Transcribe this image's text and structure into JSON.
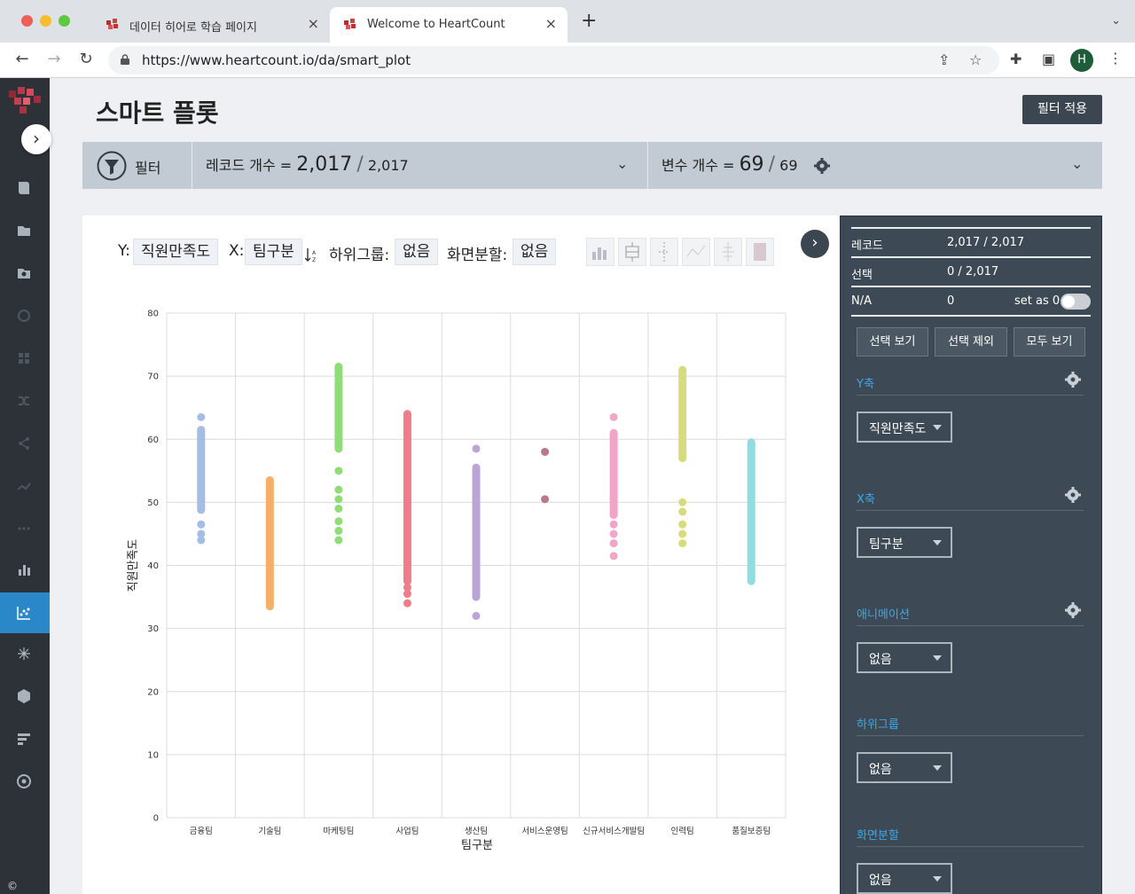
{
  "browser": {
    "tabs": [
      {
        "title": "데이터 히어로 학습 페이지",
        "active": false
      },
      {
        "title": "Welcome to HeartCount",
        "active": true
      }
    ],
    "url": "https://www.heartcount.io/da/smart_plot",
    "profile_initial": "H"
  },
  "page": {
    "title": "스마트 플롯",
    "apply_filter_label": "필터 적용"
  },
  "filterbar": {
    "filter_label": "필터",
    "record_label": "레코드 개수 =",
    "record_selected": "2,017",
    "record_sep": "/",
    "record_total": "2,017",
    "var_label": "변수 개수 =",
    "var_selected": "69",
    "var_sep": "/",
    "var_total": "69"
  },
  "controls": {
    "y_label": "Y:",
    "y_value": "직원만족도",
    "x_label": "X:",
    "x_value": "팀구분",
    "sort_icon": "sort-az-icon",
    "subgroup_label": "하위그룹:",
    "subgroup_value": "없음",
    "split_label": "화면분할:",
    "split_value": "없음"
  },
  "panel": {
    "rows": [
      {
        "key": "레코드",
        "value": "2,017 / 2,017"
      },
      {
        "key": "선택",
        "value": "0 / 2,017"
      },
      {
        "key": "N/A",
        "value": "0",
        "toggle_label": "set as 0",
        "toggle_on": false
      }
    ],
    "buttons": [
      "선택 보기",
      "선택 제외",
      "모두 보기"
    ],
    "sections": [
      {
        "title": "Y축",
        "value": "직원만족도",
        "gear": true
      },
      {
        "title": "X축",
        "value": "팀구분",
        "gear": true
      },
      {
        "title": "애니메이션",
        "value": "없음",
        "gear": true
      },
      {
        "title": "하위그룹",
        "value": "없음",
        "gear": false
      },
      {
        "title": "화면분할",
        "value": "없음",
        "gear": false
      }
    ]
  },
  "copyright": "©",
  "chart_data": {
    "type": "scatter",
    "xlabel": "팀구분",
    "ylabel": "직원만족도",
    "ylim": [
      0,
      80
    ],
    "yticks": [
      0,
      10,
      20,
      30,
      40,
      50,
      60,
      70,
      80
    ],
    "grid": true,
    "categories": [
      "금융팀",
      "기술팀",
      "마케팅팀",
      "사업팀",
      "생산팀",
      "서비스운영팀",
      "신규서비스개발팀",
      "인력팀",
      "품질보증팀"
    ],
    "series": [
      {
        "category": "금융팀",
        "color": "#a6bde3",
        "min": 44,
        "max": 63.5,
        "band": [
          48.8,
          61.5
        ],
        "points": [
          44,
          45,
          46.5,
          63.5
        ]
      },
      {
        "category": "기술팀",
        "color": "#f4b06a",
        "min": 33.5,
        "max": 53.5,
        "band": [
          33.5,
          53.5
        ],
        "points": []
      },
      {
        "category": "마케팅팀",
        "color": "#90dc77",
        "min": 44,
        "max": 71.5,
        "band": [
          58.5,
          71.5
        ],
        "points": [
          44,
          45.5,
          47,
          49,
          50.5,
          52,
          55
        ]
      },
      {
        "category": "사업팀",
        "color": "#f07b8b",
        "min": 34,
        "max": 64,
        "band": [
          37.5,
          64
        ],
        "points": [
          34,
          35.5,
          36.5
        ]
      },
      {
        "category": "생산팀",
        "color": "#b9a6d6",
        "min": 32,
        "max": 58.5,
        "band": [
          35,
          55.5
        ],
        "points": [
          32,
          58.5
        ]
      },
      {
        "category": "서비스운영팀",
        "color": "#b87a86",
        "min": 50.5,
        "max": 58,
        "band": null,
        "points": [
          50.5,
          58
        ]
      },
      {
        "category": "신규서비스개발팀",
        "color": "#f2a6c7",
        "min": 41.5,
        "max": 63.5,
        "band": [
          48,
          61
        ],
        "points": [
          41.5,
          43.5,
          45,
          46.5,
          63.5
        ]
      },
      {
        "category": "인력팀",
        "color": "#d7dc7a",
        "min": 43.5,
        "max": 71,
        "band": [
          57,
          71
        ],
        "points": [
          43.5,
          45,
          46.5,
          48.5,
          50
        ]
      },
      {
        "category": "품질보증팀",
        "color": "#8fdde0",
        "min": 37.5,
        "max": 59.5,
        "band": [
          37.5,
          59.5
        ],
        "points": []
      }
    ]
  }
}
